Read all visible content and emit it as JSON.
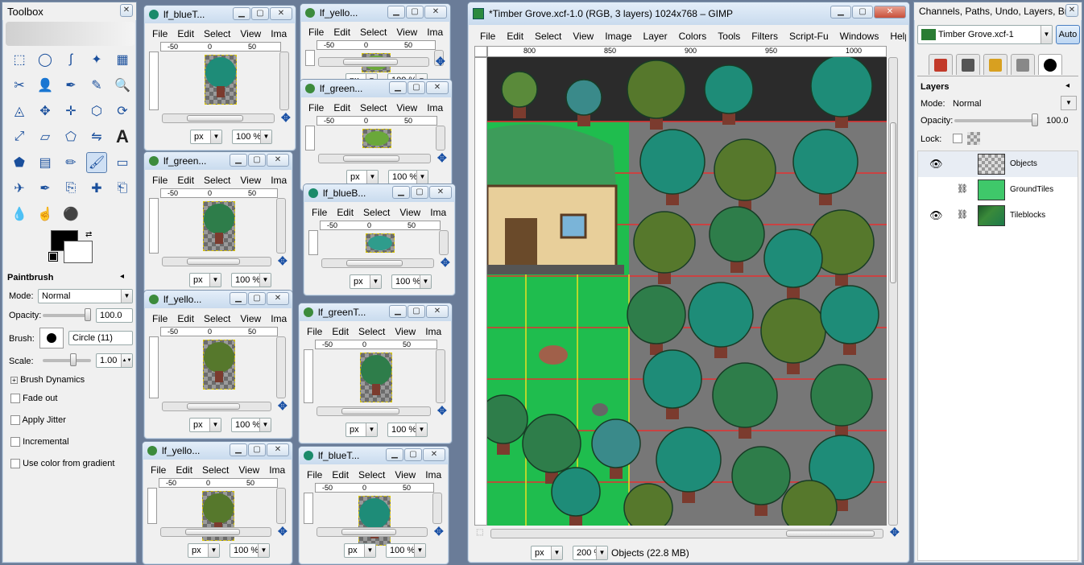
{
  "colors": {
    "grass": "#1fbd4e",
    "teal": "#1e8c78",
    "olive": "#56782c",
    "trunk": "#7b3b2e"
  },
  "toolbox": {
    "title": "Toolbox",
    "options_title": "Paintbrush",
    "mode_label": "Mode:",
    "mode_value": "Normal",
    "opacity_label": "Opacity:",
    "opacity_value": "100.0",
    "brush_label": "Brush:",
    "brush_value": "Circle (11)",
    "scale_label": "Scale:",
    "scale_value": "1.00",
    "dynamics_label": "Brush Dynamics",
    "options": [
      "Fade out",
      "Apply Jitter",
      "Incremental",
      "Use color from gradient"
    ]
  },
  "small_windows": [
    {
      "title": "lf_blueT...",
      "zoom": "100 %",
      "unit": "px",
      "ruler": [
        "-50",
        "0",
        "50"
      ],
      "tree": "teal"
    },
    {
      "title": "lf_yello...",
      "zoom": "100 %",
      "unit": "px",
      "ruler": [
        "-50",
        "0",
        "50"
      ],
      "tree": "bush"
    },
    {
      "title": "lf_green...",
      "zoom": "100 %",
      "unit": "px",
      "ruler": [
        "-50",
        "0",
        "50"
      ],
      "tree": "bush"
    },
    {
      "title": "lf_green...",
      "zoom": "100 %",
      "unit": "px",
      "ruler": [
        "-50",
        "0",
        "50"
      ],
      "tree": "green"
    },
    {
      "title": "lf_blueB...",
      "zoom": "100 %",
      "unit": "px",
      "ruler": [
        "-50",
        "0",
        "50"
      ],
      "tree": "teal-bush"
    },
    {
      "title": "lf_yello...",
      "zoom": "100 %",
      "unit": "px",
      "ruler": [
        "-50",
        "0",
        "50"
      ],
      "tree": "olive"
    },
    {
      "title": "lf_greenT...",
      "zoom": "100 %",
      "unit": "px",
      "ruler": [
        "-50",
        "0",
        "50"
      ],
      "tree": "green"
    },
    {
      "title": "lf_yello...",
      "zoom": "100 %",
      "unit": "px",
      "ruler": [
        "-50",
        "0",
        "50"
      ],
      "tree": "olive"
    },
    {
      "title": "lf_blueT...",
      "zoom": "100 %",
      "unit": "px",
      "ruler": [
        "-50",
        "0",
        "50"
      ],
      "tree": "teal"
    }
  ],
  "menu_short": [
    "File",
    "Edit",
    "Select",
    "View",
    "Ima"
  ],
  "main": {
    "title": "*Timber Grove.xcf-1.0 (RGB, 3 layers) 1024x768 – GIMP",
    "menu": [
      "File",
      "Edit",
      "Select",
      "View",
      "Image",
      "Layer",
      "Colors",
      "Tools",
      "Filters",
      "Script-Fu",
      "Windows",
      "Help"
    ],
    "ruler": [
      "800",
      "850",
      "900",
      "950",
      "1000"
    ],
    "unit": "px",
    "zoom": "200 %",
    "status": "Objects (22.8 MB)"
  },
  "layers_panel": {
    "title": "Channels, Paths, Undo, Layers, Br...",
    "image_combo": "Timber Grove.xcf-1",
    "auto_label": "Auto",
    "section_title": "Layers",
    "mode_label": "Mode:",
    "mode_value": "Normal",
    "opacity_label": "Opacity:",
    "opacity_value": "100.0",
    "lock_label": "Lock:",
    "layers": [
      {
        "name": "Objects",
        "visible": true
      },
      {
        "name": "GroundTiles",
        "visible": false
      },
      {
        "name": "Tileblocks",
        "visible": true
      }
    ]
  }
}
